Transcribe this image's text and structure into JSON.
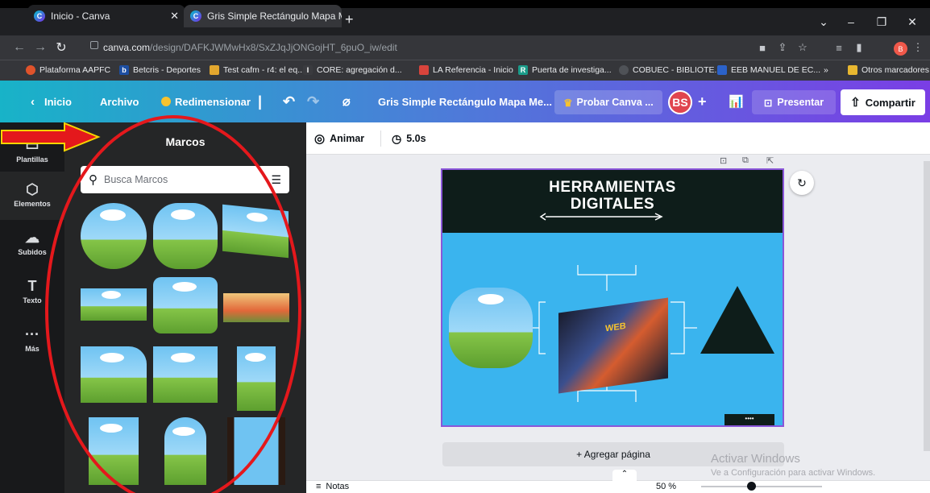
{
  "browser": {
    "tabs": [
      {
        "title": "Inicio - Canva",
        "active": false
      },
      {
        "title": "Gris Simple Rectángulo Mapa Me",
        "active": true
      }
    ],
    "new_tab": "+",
    "url_host": "canva.com",
    "url_path": "/design/DAFKJWMwHx8/SxZJqJjONGojHT_6puO_iw/edit",
    "profile_letter": "B",
    "bookmarks": [
      {
        "label": "Plataforma AAPFC",
        "icon_color": "#e0532b"
      },
      {
        "label": "Betcris - Deportes",
        "icon_color": "#1d4fa3"
      },
      {
        "label": "Test cafm - r4: el eq...",
        "icon_color": "#e2a72e"
      },
      {
        "label": "CORE: agregación d...",
        "icon_color": "#3a3b3f"
      },
      {
        "label": "LA Referencia - Inicio",
        "icon_color": "#d8443c"
      },
      {
        "label": "Puerta de investiga...",
        "icon_color": "#1a9c8a"
      },
      {
        "label": "COBUEC - BIBLIOTE...",
        "icon_color": "#4f5257"
      },
      {
        "label": "EEB MANUEL DE EC...",
        "icon_color": "#2b62c9"
      }
    ],
    "bookmarks_more": "»",
    "other_bookmarks": "Otros marcadores"
  },
  "canva": {
    "home": "Inicio",
    "file": "Archivo",
    "resize": "Redimensionar",
    "doc_title": "Gris Simple Rectángulo Mapa Me...",
    "try_pro": "Probar Canva ...",
    "avatar": "BS",
    "add": "+",
    "present": "Presentar",
    "share": "Compartir",
    "colors": {
      "page_bg": "#3ab4ee",
      "page_header": "#0e1d1a",
      "selection": "#8a56d9"
    }
  },
  "rail": [
    {
      "label": "Plantillas",
      "icon": "template-icon"
    },
    {
      "label": "Elementos",
      "icon": "elements-icon"
    },
    {
      "label": "Subidos",
      "icon": "upload-icon"
    },
    {
      "label": "Texto",
      "icon": "text-icon"
    },
    {
      "label": "Más",
      "icon": "more-icon"
    }
  ],
  "panel": {
    "title": "Marcos",
    "search_placeholder": "Busca Marcos"
  },
  "editor": {
    "animate": "Animar",
    "duration": "5.0s",
    "page_title_line1": "HERRAMIENTAS",
    "page_title_line2": "DIGITALES",
    "image_label": "WEB",
    "add_page": "+ Agregar página",
    "notes": "Notas",
    "zoom": "50 %"
  },
  "watermark": {
    "line1": "Activar Windows",
    "line2": "Ve a Configuración para activar Windows."
  }
}
